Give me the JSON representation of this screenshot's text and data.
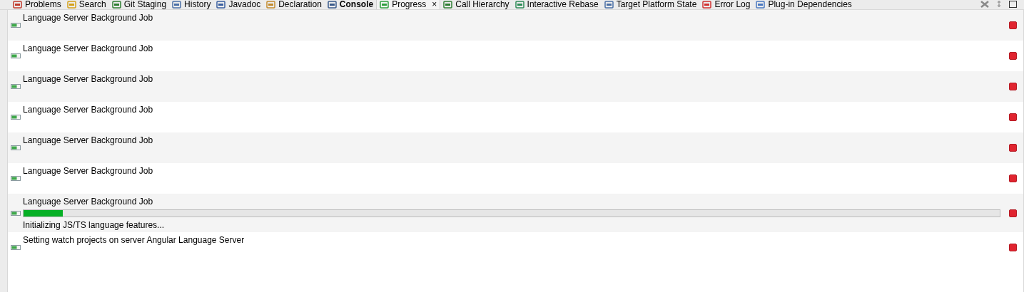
{
  "tabs": [
    {
      "label": "Problems",
      "selected": false,
      "updated": false
    },
    {
      "label": "Search",
      "selected": false,
      "updated": false
    },
    {
      "label": "Git Staging",
      "selected": false,
      "updated": false
    },
    {
      "label": "History",
      "selected": false,
      "updated": false
    },
    {
      "label": "Javadoc",
      "selected": false,
      "updated": false
    },
    {
      "label": "Declaration",
      "selected": false,
      "updated": false
    },
    {
      "label": "Console",
      "selected": false,
      "updated": true
    },
    {
      "label": "Progress",
      "selected": true,
      "updated": false,
      "close": "×"
    },
    {
      "label": "Call Hierarchy",
      "selected": false,
      "updated": false
    },
    {
      "label": "Interactive Rebase",
      "selected": false,
      "updated": false
    },
    {
      "label": "Target Platform State",
      "selected": false,
      "updated": false
    },
    {
      "label": "Error Log",
      "selected": false,
      "updated": false
    },
    {
      "label": "Plug-in Dependencies",
      "selected": false,
      "updated": false
    }
  ],
  "jobs": [
    {
      "kind": "job",
      "name": "Language Server Background Job"
    },
    {
      "kind": "job",
      "name": "Language Server Background Job"
    },
    {
      "kind": "job",
      "name": "Language Server Background Job"
    },
    {
      "kind": "job",
      "name": "Language Server Background Job"
    },
    {
      "kind": "job",
      "name": "Language Server Background Job"
    },
    {
      "kind": "job",
      "name": "Language Server Background Job"
    },
    {
      "kind": "progress",
      "name": "Language Server Background Job",
      "level": 0.04,
      "status": "Initializing JS/TS language features..."
    },
    {
      "kind": "job",
      "name": "Setting watch projects on server Angular Language Server"
    }
  ]
}
